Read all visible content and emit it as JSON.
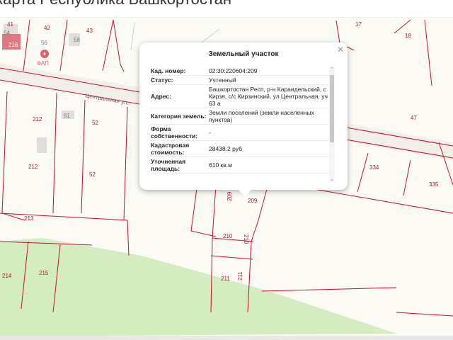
{
  "header": {
    "title": "карта Республика Башкортостан"
  },
  "map": {
    "street_label": "Центральная ул.",
    "poi": {
      "label": "ФАП",
      "icon": "medical-cross-icon"
    },
    "parcel_labels": [
      "41",
      "42",
      "43",
      "54",
      "56",
      "58",
      "216",
      "212",
      "61",
      "52",
      "212",
      "52",
      "213",
      "214",
      "215",
      "209",
      "209",
      "210",
      "210",
      "211",
      "211",
      "17",
      "18",
      "47",
      "334",
      "335"
    ],
    "colors": {
      "boundary": "#c8102e",
      "green": "#d3ecc0",
      "background": "#fbfaf4"
    }
  },
  "popup": {
    "title": "Земельный участок",
    "rows": [
      {
        "key": "Кад. номер:",
        "value": "02:30:220604:209"
      },
      {
        "key": "Статус:",
        "value": "Учтенный"
      },
      {
        "key": "Адрес:",
        "value": "Башкортостан Респ, р-н Караидельский, с Кирзя, с/с Кирзинский, ул Центральная, уч 63 а"
      },
      {
        "key": "Категория земель:",
        "value": "Земли поселений (земли населенных пунктов)"
      },
      {
        "key": "Форма собственности:",
        "value": "-"
      },
      {
        "key": "Кадастровая стоимость:",
        "value": "28438.2 руб"
      },
      {
        "key": "Уточненная площадь:",
        "value": "610 кв.м"
      }
    ]
  }
}
